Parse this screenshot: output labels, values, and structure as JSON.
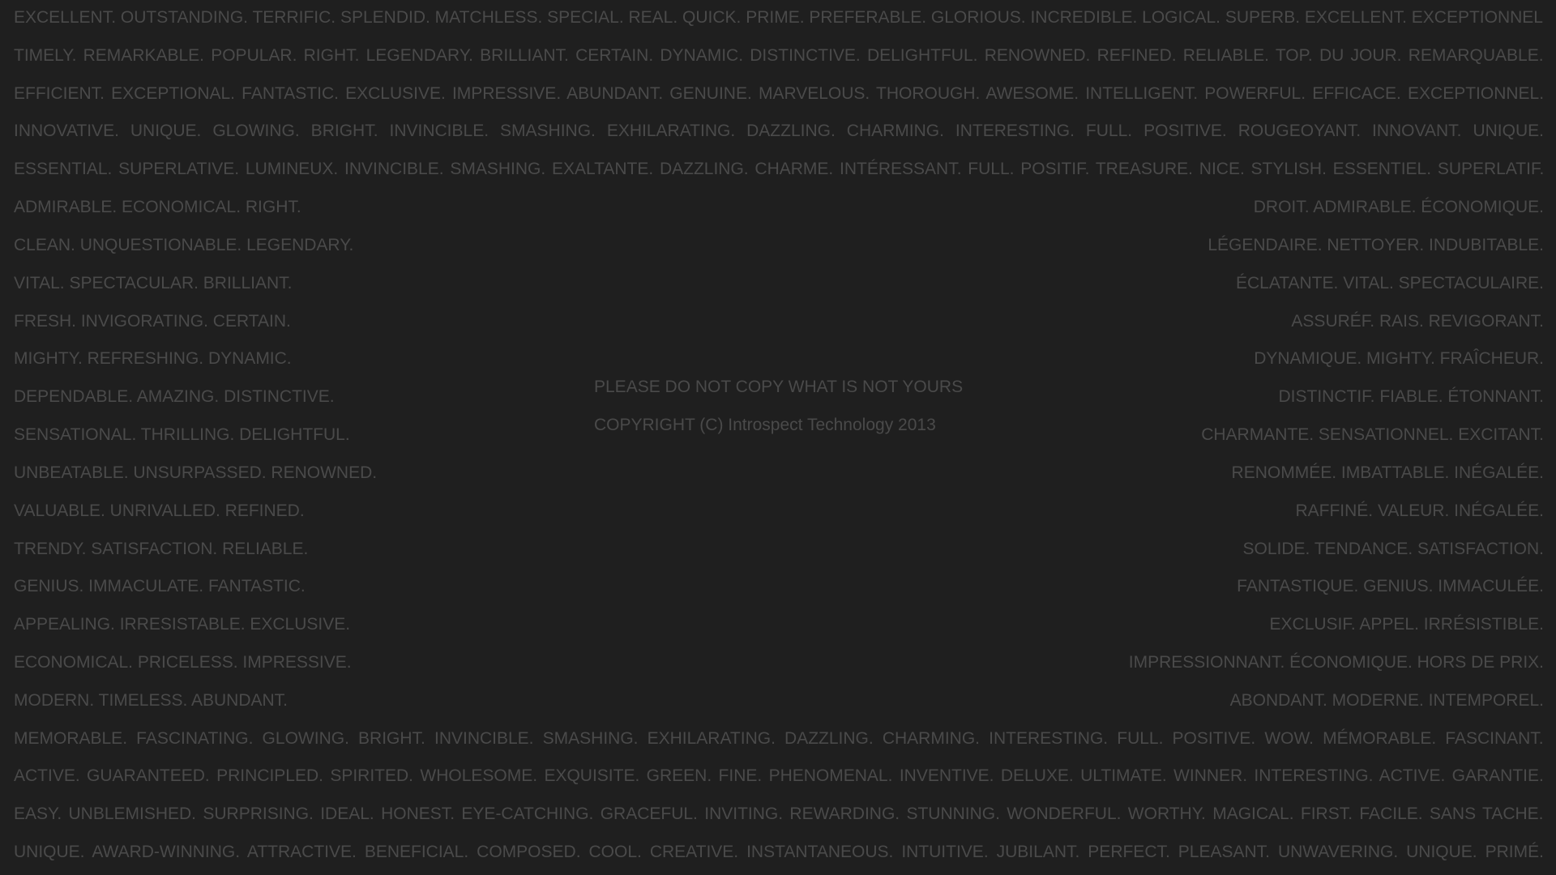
{
  "full_rows": [
    "EXCELLENT. OUTSTANDING.  TERRIFIC. SPLENDID. MATCHLESS. SPECIAL. REAL. QUICK. PRIME. PREFERABLE. GLORIOUS. INCREDIBLE. LOGICAL. SUPERB.  EXCELLENT. EXCEPTIONNEL.",
    "TIMELY. REMARKABLE. POPULAR. RIGHT. LEGENDARY. BRILLIANT. CERTAIN. DYNAMIC. DISTINCTIVE. DELIGHTFUL. RENOWNED. REFINED. RELIABLE. TOP.  DU JOUR. REMARQUABLE.",
    "EFFICIENT. EXCEPTIONAL.  FANTASTIC. EXCLUSIVE. IMPRESSIVE. ABUNDANT. GENUINE. MARVELOUS. THOROUGH. AWESOME. INTELLIGENT. POWERFUL.  EFFICACE. EXCEPTIONNEL.",
    "INNOVATIVE. UNIQUE.    GLOWING.  BRIGHT. INVINCIBLE. SMASHING.  EXHILARATING. DAZZLING.  CHARMING. INTERESTING. FULL.  POSITIVE. ROUGEOYANT.  INNOVANT. UNIQUE.",
    "ESSENTIAL. SUPERLATIVE.    LUMINEUX. INVINCIBLE.  SMASHING.  EXALTANTE. DAZZLING. CHARME. INTÉRESSANT. FULL. POSITIF. TREASURE. NICE. STYLISH. ESSENTIEL. SUPERLATIF."
  ],
  "side_rows": [
    {
      "left": "ADMIRABLE. ECONOMICAL. RIGHT.",
      "right": "DROIT. ADMIRABLE. ÉCONOMIQUE."
    },
    {
      "left": "CLEAN. UNQUESTIONABLE. LEGENDARY.",
      "right": "LÉGENDAIRE. NETTOYER. INDUBITABLE."
    },
    {
      "left": "VITAL. SPECTACULAR. BRILLIANT.",
      "right": "ÉCLATANTE. VITAL. SPECTACULAIRE."
    },
    {
      "left": "FRESH. INVIGORATING. CERTAIN.",
      "right": "ASSURÉF. RAIS. REVIGORANT."
    },
    {
      "left": "MIGHTY. REFRESHING. DYNAMIC.",
      "right": "DYNAMIQUE. MIGHTY. FRAÎCHEUR."
    },
    {
      "left": "DEPENDABLE. AMAZING. DISTINCTIVE.",
      "right": "DISTINCTIF. FIABLE. ÉTONNANT."
    },
    {
      "left": "SENSATIONAL. THRILLING. DELIGHTFUL.",
      "right": "CHARMANTE. SENSATIONNEL. EXCITANT."
    },
    {
      "left": "UNBEATABLE. UNSURPASSED. RENOWNED.",
      "right": "RENOMMÉE. IMBATTABLE. INÉGALÉE."
    },
    {
      "left": "VALUABLE. UNRIVALLED. REFINED.",
      "right": "RAFFINÉ. VALEUR. INÉGALÉE."
    },
    {
      "left": "TRENDY. SATISFACTION. RELIABLE.",
      "right": "SOLIDE. TENDANCE. SATISFACTION."
    },
    {
      "left": "GENIUS. IMMACULATE. FANTASTIC.",
      "right": "FANTASTIQUE. GENIUS. IMMACULÉE."
    },
    {
      "left": "APPEALING. IRRESISTABLE. EXCLUSIVE.",
      "right": "EXCLUSIF. APPEL. IRRÉSISTIBLE."
    },
    {
      "left": "ECONOMICAL. PRICELESS. IMPRESSIVE.",
      "right": "IMPRESSIONNANT. ÉCONOMIQUE. HORS DE PRIX."
    },
    {
      "left": "MODERN. TIMELESS. ABUNDANT.",
      "right": "ABONDANT. MODERNE. INTEMPOREL."
    }
  ],
  "bottom_rows": [
    "MEMORABLE. FASCINATING.  GLOWING. BRIGHT. INVINCIBLE. SMASHING. EXHILARATING. DAZZLING. CHARMING. INTERESTING. FULL. POSITIVE. WOW.  MÉMORABLE. FASCINANT.",
    "ACTIVE. GUARANTEED. PRINCIPLED.  SPIRITED. WHOLESOME. EXQUISITE. GREEN.  FINE. PHENOMENAL. INVENTIVE. DELUXE. ULTIMATE. WINNER. INTERESTING. ACTIVE. GARANTIE.",
    "EASY. UNBLEMISHED. SURPRISING. IDEAL. HONEST. EYE-CATCHING. GRACEFUL. INVITING. REWARDING. STUNNING. WONDERFUL. WORTHY. MAGICAL. FIRST.  FACILE. SANS TACHE.",
    "UNIQUE. AWARD-WINNING. ATTRACTIVE. BENEFICIAL. COMPOSED. COOL. CREATIVE. INSTANTANEOUS. INTUITIVE. JUBILANT. PERFECT. PLEASANT. UNWAVERING. UNIQUE. PRIMÉ."
  ],
  "center": {
    "line1": "PLEASE DO NOT COPY WHAT IS NOT YOURS",
    "line2": "COPYRIGHT (C) Introspect Technology 2013"
  }
}
